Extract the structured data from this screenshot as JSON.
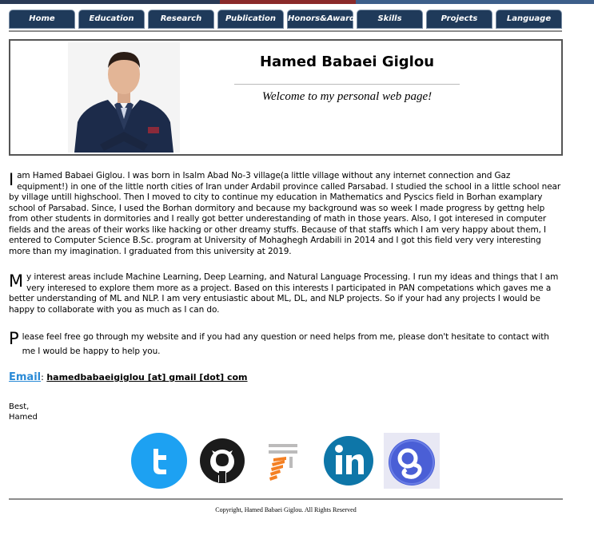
{
  "nav": {
    "items": [
      {
        "label": "Home"
      },
      {
        "label": "Education"
      },
      {
        "label": "Research"
      },
      {
        "label": "Publication"
      },
      {
        "label": "Honors&Awards"
      },
      {
        "label": "Skills"
      },
      {
        "label": "Projects"
      },
      {
        "label": "Language"
      }
    ]
  },
  "header": {
    "name": "Hamed Babaei Giglou",
    "welcome": "Welcome to my personal web page!"
  },
  "bio": {
    "p1_cap": "I",
    "p1": "am Hamed Babaei Giglou. I was born in Isalm Abad No-3 village(a little village without any internet connection and Gaz equipment!) in one of the little north cities of Iran under Ardabil province called Parsabad. I studied the school in a little school near by village untill highschool. Then I moved to city to continue my education in Mathematics and Pyscics field in Borhan examplary school of Parsabad. Since, I used the Borhan dormitory and because my background was so week I made progress by gettng help from other students in dormitories and I really got better underestanding of math in those years. Also, I got interesed in computer fields and the areas of their works like hacking or other dreamy stuffs. Because of that staffs which I am very happy about them, I entered to Computer Science B.Sc. program at University of Mohaghegh Ardabili in 2014 and I got this field very very interesting more than my imagination. I graduated from this university at 2019.",
    "p2_cap": "M",
    "p2": "y interest areas include Machine Learning, Deep Learning, and Natural Language Processing. I run my ideas and things that I am very interesed to explore them more as a project. Based on this interests I participated in PAN competations which gaves me a better understanding of ML and NLP. I am very entusiastic about ML, DL, and NLP projects. So if your had any projects I would be happy to collaborate with you as much as I can do.",
    "p3_cap": "P",
    "p3": "lease feel free go through my website and if you had any question or need helps from me, please don't hesitate to contact with me I would be happy to help you."
  },
  "contact": {
    "email_label": "Email",
    "separator": ": ",
    "email_value": "hamedbabaeigiglou [at] gmail [dot] com"
  },
  "signature": {
    "line1": "Best,",
    "line2": "Hamed"
  },
  "social": {
    "icons": [
      "twitter-icon",
      "github-icon",
      "stackoverflow-icon",
      "linkedin-icon",
      "google-scholar-icon"
    ]
  },
  "footer": {
    "copyright": "Copyright, Hamed Babaei Giglou. All Rights Reserved"
  },
  "colors": {
    "nav_bg": "#1f3a5a",
    "email_blue": "#2a8ad6",
    "twitter": "#1da1f2",
    "linkedin": "#0e76a8",
    "scholar": "#4a5fd6"
  }
}
